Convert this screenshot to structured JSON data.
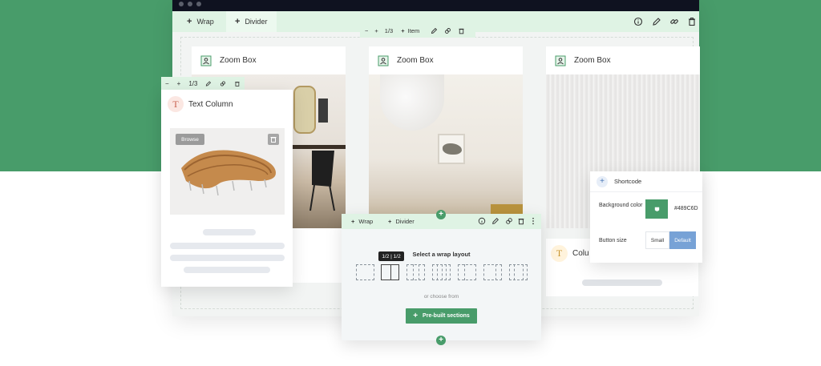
{
  "main_toolbar": {
    "wrap_label": "Wrap",
    "divider_label": "Divider"
  },
  "item_toolbar": {
    "minus": "−",
    "plus": "+",
    "fraction": "1/3",
    "item_label": "Item"
  },
  "cards": [
    {
      "title": "Zoom Box"
    },
    {
      "title": "Zoom Box"
    },
    {
      "title": "Zoom Box"
    }
  ],
  "text_column": {
    "toolbar_minus": "−",
    "toolbar_plus": "+",
    "toolbar_fraction": "1/3",
    "badge": "T",
    "title": "Text Column",
    "browse_label": "Browse"
  },
  "wrap_panel": {
    "wrap_label": "Wrap",
    "divider_label": "Divider",
    "select_label": "Select a wrap layout",
    "tooltip": "1/2 | 1/2",
    "choose_label": "or choose from",
    "prebuilt_label": "Pre-built sections"
  },
  "shortcode_panel": {
    "title": "Shortcode",
    "bg_color_label": "Background color",
    "bg_color_value": "#489C6D",
    "button_size_label": "Button size",
    "size_small": "Small",
    "size_default": "Default",
    "selected_size": "Default"
  },
  "column_card": {
    "badge": "T",
    "title": "Colu"
  },
  "colors": {
    "brand_green": "#489c6a",
    "toolbar_green": "#dff3e4",
    "accent_blue": "#77a2d6"
  }
}
